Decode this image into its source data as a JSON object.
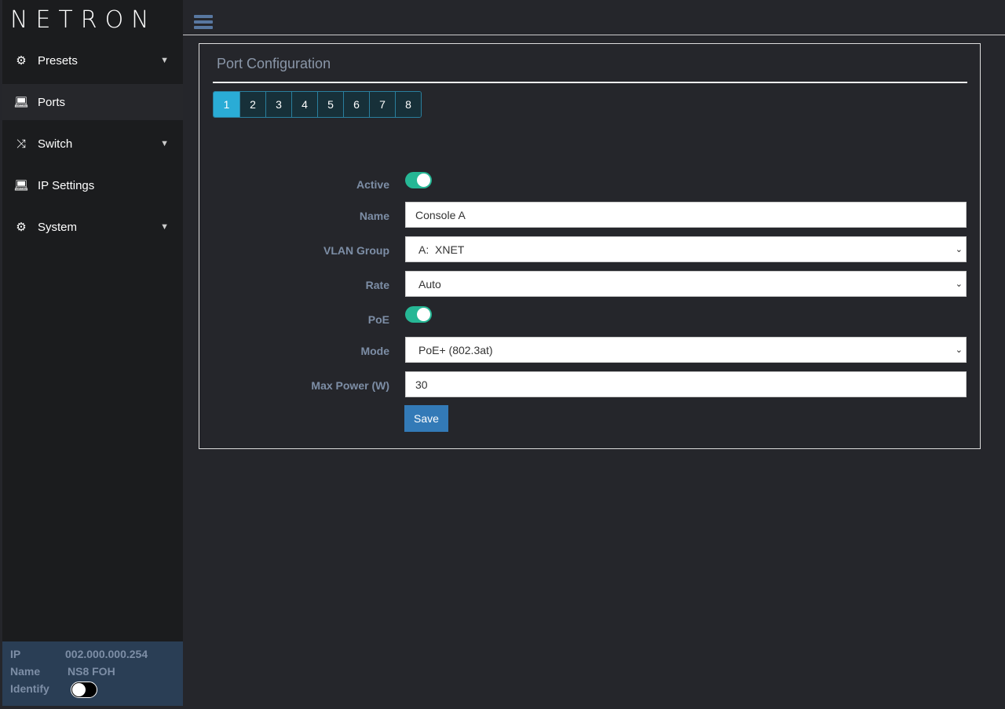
{
  "brand": "NETRON",
  "sidebar": {
    "items": [
      {
        "label": "Presets",
        "icon": "gear-icon",
        "expandable": true
      },
      {
        "label": "Ports",
        "icon": "laptop-icon",
        "active": true
      },
      {
        "label": "Switch",
        "icon": "shuffle-icon",
        "expandable": true
      },
      {
        "label": "IP Settings",
        "icon": "laptop-icon"
      },
      {
        "label": "System",
        "icon": "gear-icon",
        "expandable": true
      }
    ]
  },
  "device": {
    "ip_label": "IP",
    "ip": "002.000.000.254",
    "name_label": "Name",
    "name": "NS8 FOH",
    "identify_label": "Identify",
    "identify": false
  },
  "card": {
    "title": "Port Configuration",
    "ports": [
      "1",
      "2",
      "3",
      "4",
      "5",
      "6",
      "7",
      "8"
    ],
    "selected_port": "1"
  },
  "form": {
    "active_label": "Active",
    "active": true,
    "name_label": "Name",
    "name": "Console A",
    "vlan_label": "VLAN Group",
    "vlan": "A:  XNET",
    "rate_label": "Rate",
    "rate": "Auto",
    "poe_label": "PoE",
    "poe": true,
    "mode_label": "Mode",
    "mode": "PoE+ (802.3at)",
    "max_power_label": "Max Power (W)",
    "max_power": "30",
    "save_label": "Save"
  },
  "colors": {
    "accent": "#2aacd6",
    "toggle_on": "#26b795",
    "save": "#337ab7"
  }
}
